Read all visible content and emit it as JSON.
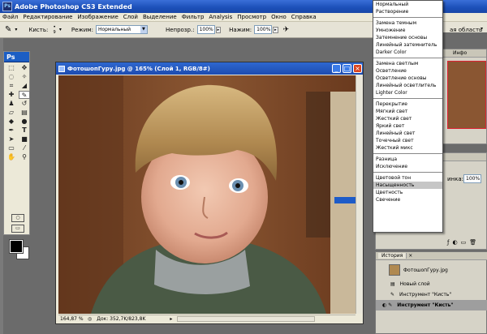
{
  "window": {
    "title": "Adobe Photoshop CS3 Extended",
    "app_badge": "Ps"
  },
  "menu": [
    "Файл",
    "Редактирование",
    "Изображение",
    "Слой",
    "Выделение",
    "Фильтр",
    "Analysis",
    "Просмотр",
    "Окно",
    "Справка"
  ],
  "options": {
    "brush_label": "Кисть:",
    "brush_size": "9",
    "mode_label": "Режим:",
    "mode_value": "Нормальный",
    "opacity_label": "Непрозр.:",
    "opacity_value": "100%",
    "flow_label": "Нажим:",
    "flow_value": "100%",
    "workspace_fragment": "ая область"
  },
  "document": {
    "title": "ФотошопГуру.jpg @ 165% (Слой 1, RGB/8#)",
    "zoom": "164,87 %",
    "doc_size": "Док: 352,7K/823,8K"
  },
  "blend_menu": {
    "groups": [
      [
        "Нормальный",
        "Растворение"
      ],
      [
        "Замена темным",
        "Умножение",
        "Затемнение основы",
        "Линейный затемнитель",
        "Darker Color"
      ],
      [
        "Замена светлым",
        "Осветление",
        "Осветление основы",
        "Линейный осветлитель",
        "Lighter Color"
      ],
      [
        "Перекрытие",
        "Мягкий свет",
        "Жесткий свет",
        "Яркий свет",
        "Линейный свет",
        "Точечный свет",
        "Жесткий микс"
      ],
      [
        "Разница",
        "Исключение"
      ],
      [
        "Цветовой тон",
        "Насыщенность",
        "Цветность",
        "Свечение"
      ]
    ],
    "highlighted": "Насыщенность"
  },
  "panels": {
    "navigator_tab": "Инфо",
    "layers_label": "инка:",
    "layers_value": "100%",
    "history_tab": "История"
  },
  "history": {
    "snapshot": "ФотошопГуру.jpg",
    "items": [
      "Новый слой",
      "Инструмент \"Кисть\"",
      "Инструмент \"Кисть\""
    ]
  },
  "colors": {
    "title_bar": "#1b4fb8",
    "highlight": "#c6c6c6",
    "canvas_bg": "#000000"
  }
}
